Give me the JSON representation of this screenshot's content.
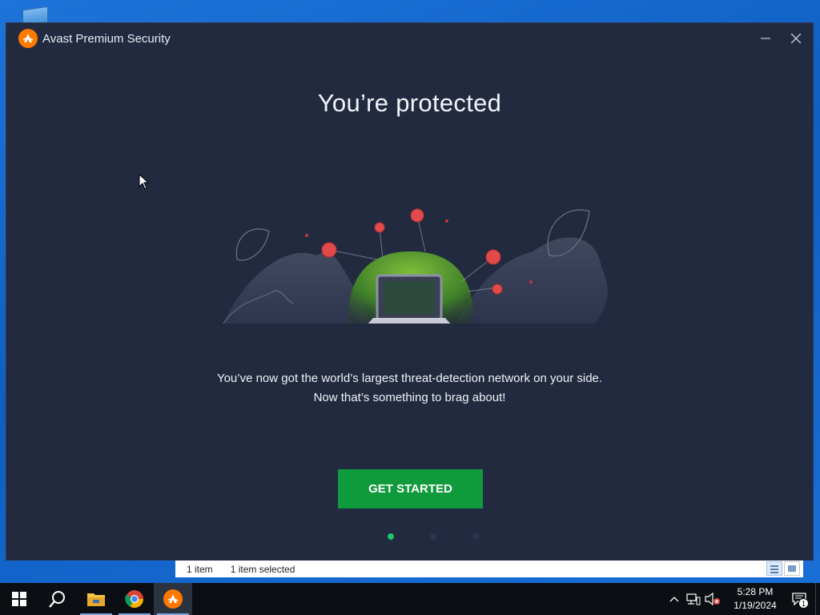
{
  "window": {
    "title": "Avast Premium Security",
    "minimize_label": "Minimize",
    "close_label": "Close"
  },
  "main": {
    "headline": "You’re protected",
    "message_line1": "You’ve now got the world’s largest threat-detection network on your side.",
    "message_line2": "Now that’s something to brag about!",
    "cta_label": "GET STARTED",
    "pager": {
      "total": 3,
      "active": 1
    }
  },
  "explorer_status": {
    "item_count": "1 item",
    "selected": "1 item selected"
  },
  "taskbar": {
    "apps": [
      {
        "name": "start",
        "icon": "windows-logo-icon"
      },
      {
        "name": "search",
        "icon": "search-icon"
      },
      {
        "name": "file-explorer",
        "icon": "folder-icon",
        "running": true
      },
      {
        "name": "chrome",
        "icon": "chrome-icon",
        "running": true
      },
      {
        "name": "avast",
        "icon": "avast-icon",
        "active": true
      }
    ],
    "clock_time": "5:28 PM",
    "clock_date": "1/19/2024",
    "notification_count": "1"
  },
  "colors": {
    "window_bg": "#222a40",
    "cta_green": "#0f9a3c",
    "pager_active": "#22c36a",
    "avast_orange": "#ff7800",
    "desktop_blue": "#1565c0"
  }
}
